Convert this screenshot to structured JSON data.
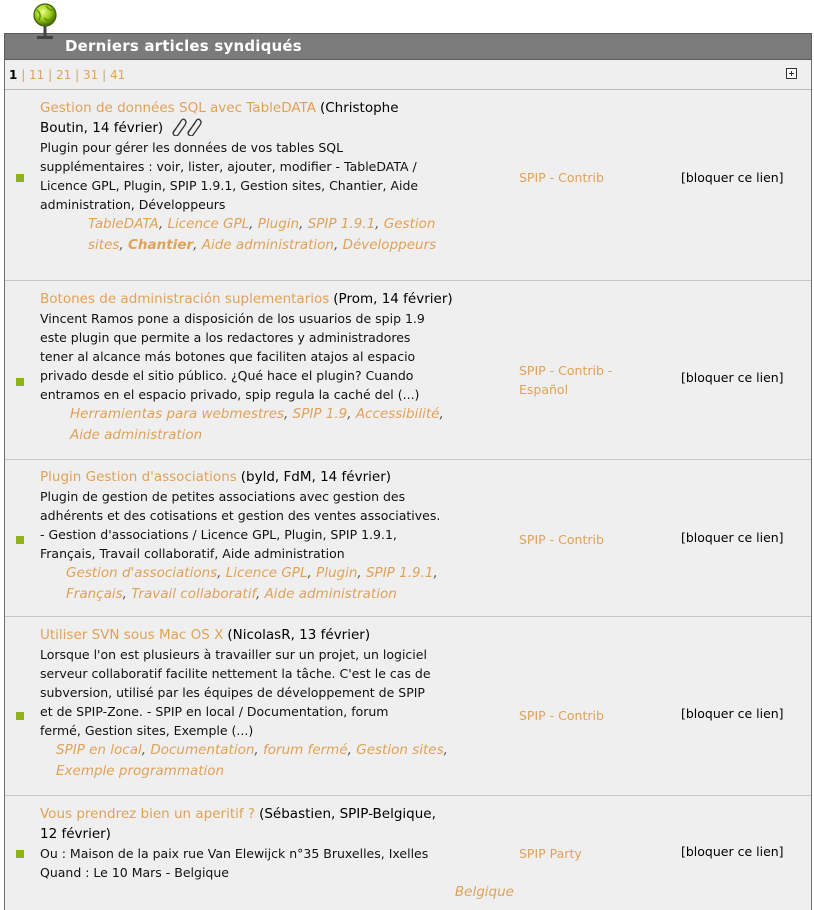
{
  "header": {
    "title": "Derniers articles syndiqués",
    "icon": "globe-icon"
  },
  "pagination": {
    "current": "1",
    "pages": [
      "11",
      "21",
      "31",
      "41"
    ],
    "expand_icon": "expand-plus-icon"
  },
  "articles": [
    {
      "title": "Gestion de données SQL avec TableDATA",
      "meta_a": "(Christophe",
      "meta_b": "Boutin, 14 février)",
      "has_attachment": true,
      "desc_lines": [
        "Plugin pour gérer les données de vos tables SQL",
        "supplémentaires : voir, lister, ajouter, modifier - TableDATA /",
        "Licence GPL, Plugin, SPIP 1.9.1, Gestion sites, Chantier, Aide",
        "administration, Développeurs"
      ],
      "tags": [
        "TableDATA",
        "Licence GPL",
        "Plugin",
        "SPIP 1.9.1",
        "Gestion",
        "sites",
        "Chantier",
        "Aide administration",
        "Développeurs"
      ],
      "site": [
        "SPIP - Contrib"
      ],
      "block": "[bloquer ce lien]"
    },
    {
      "title": "Botones de administración suplementarios",
      "meta_a": "(Prom, 14 février)",
      "desc_lines": [
        "Vincent Ramos pone a disposición de los usuarios de spip 1.9",
        "este plugin que permite a los redactores y administradores",
        "tener al alcance más botones que faciliten atajos al espacio",
        "privado desde el sitio público. ¿Qué hace el plugin? Cuando",
        "entramos en el espacio privado, spip regula la caché del (...)"
      ],
      "tags": [
        "Herramientas para webmestres",
        "SPIP 1.9",
        "Accessibilité",
        "Aide administration"
      ],
      "site": [
        "SPIP - Contrib -",
        "Español"
      ],
      "block": "[bloquer ce lien]"
    },
    {
      "title": "Plugin Gestion d'associations",
      "meta_a": "(byld, FdM, 14 février)",
      "desc_lines": [
        "Plugin de gestion de petites associations avec gestion des",
        "adhérents et des cotisations et gestion des ventes associatives.",
        "- Gestion d'associations / Licence GPL, Plugin, SPIP 1.9.1,",
        "Français, Travail collaboratif, Aide administration"
      ],
      "tags": [
        "Gestion d'associations",
        "Licence GPL",
        "Plugin",
        "SPIP 1.9.1",
        "Français",
        "Travail collaboratif",
        "Aide administration"
      ],
      "site": [
        "SPIP - Contrib"
      ],
      "block": "[bloquer ce lien]"
    },
    {
      "title": "Utiliser SVN sous Mac OS X",
      "meta_a": "(NicolasR, 13 février)",
      "desc_lines": [
        "Lorsque l'on est plusieurs à travailler sur un projet, un logiciel",
        "serveur collaboratif facilite nettement la tâche. C'est le cas de",
        "subversion, utilisé par les équipes de développement de SPIP",
        "et de SPIP-Zone. - SPIP en local / Documentation, forum",
        "fermé, Gestion sites, Exemple (...)"
      ],
      "tags": [
        "SPIP en local",
        "Documentation",
        "forum fermé",
        "Gestion sites",
        "Exemple programmation"
      ],
      "site": [
        "SPIP - Contrib"
      ],
      "block": "[bloquer ce lien]"
    },
    {
      "title": "Vous prendrez bien un aperitif ?",
      "meta_a": "(Sébastien, SPIP-Belgique,",
      "meta_b": "12 février)",
      "desc_lines": [
        "Ou : Maison de la paix rue Van Elewijck n°35 Bruxelles, Ixelles",
        "Quand : Le 10 Mars - Belgique"
      ],
      "tags": [
        "Belgique"
      ],
      "site": [
        "SPIP Party"
      ],
      "block": "[bloquer ce lien]"
    }
  ]
}
